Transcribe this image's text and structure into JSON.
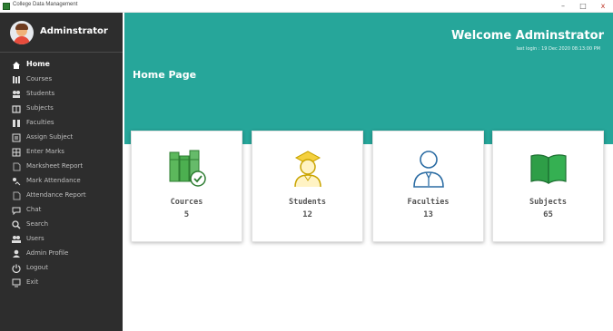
{
  "window": {
    "title": "College Data Management",
    "buttons": {
      "minimize": "–",
      "maximize": "□",
      "close": "x"
    }
  },
  "sidebar": {
    "user_name": "Adminstrator",
    "items": [
      {
        "label": "Home",
        "icon": "home-icon",
        "active": true
      },
      {
        "label": "Courses",
        "icon": "books-icon"
      },
      {
        "label": "Students",
        "icon": "students-icon"
      },
      {
        "label": "Subjects",
        "icon": "book-icon"
      },
      {
        "label": "Faculties",
        "icon": "faculties-icon"
      },
      {
        "label": "Assign Subject",
        "icon": "assign-icon"
      },
      {
        "label": "Enter Marks",
        "icon": "marks-icon"
      },
      {
        "label": "Marksheet Report",
        "icon": "report-icon"
      },
      {
        "label": "Mark Attendance",
        "icon": "attendance-icon"
      },
      {
        "label": "Attendance Report",
        "icon": "attendance-report-icon"
      },
      {
        "label": "Chat",
        "icon": "chat-icon"
      },
      {
        "label": "Search",
        "icon": "search-icon"
      },
      {
        "label": "Users",
        "icon": "users-icon"
      },
      {
        "label": "Admin Profile",
        "icon": "profile-icon"
      },
      {
        "label": "Logout",
        "icon": "logout-icon"
      },
      {
        "label": "Exit",
        "icon": "exit-icon"
      }
    ]
  },
  "header": {
    "welcome": "Welcome Adminstrator",
    "last_login": "last login : 19 Dec 2020 08:13:00 PM",
    "page_title": "Home Page"
  },
  "cards": [
    {
      "label": "Cources",
      "count": "5",
      "icon": "books-check-icon"
    },
    {
      "label": "Students",
      "count": "12",
      "icon": "student-icon"
    },
    {
      "label": "Faculties",
      "count": "13",
      "icon": "faculty-icon"
    },
    {
      "label": "Subjects",
      "count": "65",
      "icon": "open-book-icon"
    }
  ],
  "colors": {
    "sidebar_bg": "#2d2d2d",
    "banner_bg": "#26a69a",
    "card_text": "#555555"
  }
}
